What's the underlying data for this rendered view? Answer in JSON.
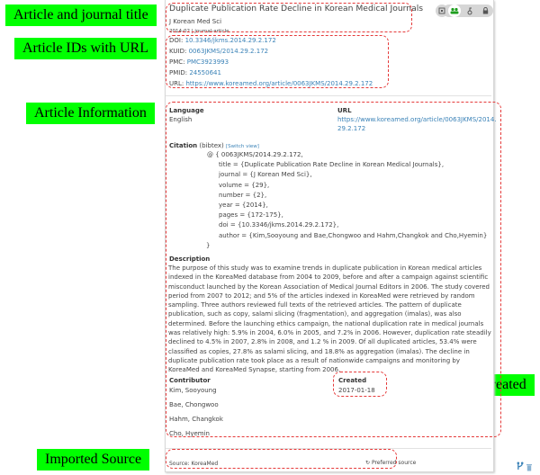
{
  "annotations": {
    "article_title": "Article and journal title",
    "article_ids": "Article IDs with URL",
    "article_info": "Article Information",
    "orcid_created": "ORCID Data Created",
    "imported_source": "Imported Source"
  },
  "header": {
    "title": "Duplicate Publication Rate Decline in Korean Medical Journals",
    "journal": "J Korean Med Sci",
    "meta": "2014-02 | journal-article",
    "icons": [
      "privacy-icon",
      "public-group-icon",
      "trusted-party-icon",
      "lock-icon"
    ]
  },
  "ids": {
    "doi_label": "DOI:",
    "doi": "10.3346/jkms.2014.29.2.172",
    "kuid_label": "KUID:",
    "kuid": "0063JKMS/2014.29.2.172",
    "pmc_label": "PMC:",
    "pmc": "PMC3923993",
    "pmid_label": "PMID:",
    "pmid": "24550641",
    "url_label": "URL:",
    "url": "https://www.koreamed.org/article/0063JKMS/2014.29.2.172"
  },
  "info": {
    "language_label": "Language",
    "language": "English",
    "url_label": "URL",
    "url_line1": "https://www.koreamed.org/article/0063JKMS/2014.",
    "url_line2": "29.2.172",
    "citation_label": "Citation",
    "citation_type": "(bibtex)",
    "switch_view": "[Switch view]",
    "citation_lines": [
      "@ { 0063JKMS/2014.29.2.172,",
      "title = {Duplicate Publication Rate Decline in Korean Medical Journals},",
      "journal = {J Korean Med Sci},",
      "volume = {29},",
      "number = {2},",
      "year = {2014},",
      "pages = {172-175},",
      "doi = {10.3346/jkms.2014.29.2.172},",
      "author = {Kim,Sooyoung and Bae,Chongwoo and Hahm,Changkok and Cho,Hyemin}",
      "}"
    ],
    "description_label": "Description",
    "description": "The purpose of this study was to examine trends in duplicate publication in Korean medical articles indexed in the KoreaMed database from 2004 to 2009, before and after a campaign against scientific misconduct launched by the Korean Association of Medical Journal Editors in 2006. The study covered period from 2007 to 2012; and 5% of the articles indexed in KoreaMed were retrieved by random sampling. Three authors reviewed full texts of the retrieved articles. The pattern of duplicate publication, such as copy, salami slicing (fragmentation), and aggregation (imalas), was also determined. Before the launching ethics campaign, the national duplication rate in medical journals was relatively high: 5.9% in 2004, 6.0% in 2005, and 7.2% in 2006. However, duplication rate steadily declined to 4.5% in 2007, 2.8% in 2008, and 1.2 % in 2009. Of all duplicated articles, 53.4% were classified as copies, 27.8% as salami slicing, and 18.8% as aggregation (imalas). The decline in duplicate publication rate took place as a result of nationwide campaigns and monitoring by KoreaMed and KoreaMed Synapse, starting from 2006.",
    "contributor_label": "Contributor",
    "contributors": [
      "Kim, Sooyoung",
      "Bae, Chongwoo",
      "Hahm, Changkok",
      "Cho, Hyemin"
    ],
    "created_label": "Created",
    "created": "2017-01-18"
  },
  "footer": {
    "source": "Source: KoreaMed",
    "preferred": "Preferred source",
    "colors": {
      "accent": "#3a82b7",
      "green": "#1f9e1f",
      "dash": "#e53a3a"
    }
  }
}
